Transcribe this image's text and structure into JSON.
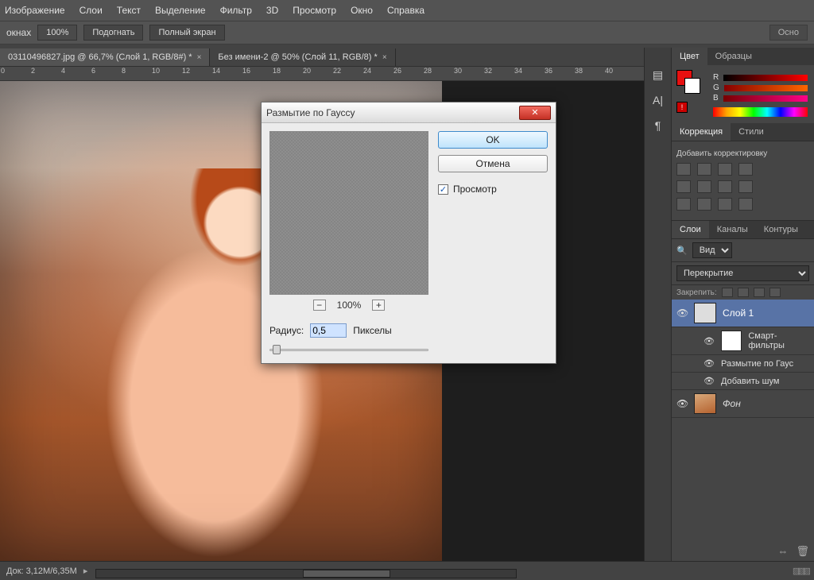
{
  "menu": {
    "items": [
      "Изображение",
      "Слои",
      "Текст",
      "Выделение",
      "Фильтр",
      "3D",
      "Просмотр",
      "Окно",
      "Справка"
    ]
  },
  "options": {
    "left_label": "окнах",
    "zoom": "100%",
    "fit": "Подогнать",
    "fullscreen": "Полный экран",
    "right_btn": "Осно"
  },
  "tabs": {
    "t1": "03110496827.jpg @ 66,7% (Слой 1, RGB/8#) *",
    "t2": "Без имени-2 @ 50% (Слой 11, RGB/8) *"
  },
  "ruler": [
    "0",
    "2",
    "4",
    "6",
    "8",
    "10",
    "12",
    "14",
    "16",
    "18",
    "20",
    "22",
    "24",
    "26",
    "28",
    "30",
    "32",
    "34",
    "36",
    "38",
    "40"
  ],
  "vbar_icons": [
    "histogram",
    "type",
    "paragraph",
    "type2"
  ],
  "color_panel": {
    "tabs": {
      "color": "Цвет",
      "swatches": "Образцы"
    },
    "r": "R",
    "g": "G",
    "b": "B"
  },
  "correction_panel": {
    "tabs": {
      "correction": "Коррекция",
      "styles": "Стили"
    },
    "add": "Добавить корректировку"
  },
  "layers_panel": {
    "tabs": {
      "layers": "Слои",
      "channels": "Каналы",
      "paths": "Контуры"
    },
    "filter_kind": "Вид",
    "blend": "Перекрытие",
    "lock": "Закрепить:",
    "items": {
      "layer1": "Слой 1",
      "smart": "Смарт-фильтры",
      "gauss": "Размытие по Гаус",
      "noise": "Добавить шум",
      "bg": "Фон"
    }
  },
  "status": {
    "doc": "Док: 3,12M/6,35M"
  },
  "dialog": {
    "title": "Размытие по Гауссу",
    "ok": "OK",
    "cancel": "Отмена",
    "preview": "Просмотр",
    "zoom": "100%",
    "radius_label": "Радиус:",
    "radius_value": "0,5",
    "radius_unit": "Пикселы"
  }
}
